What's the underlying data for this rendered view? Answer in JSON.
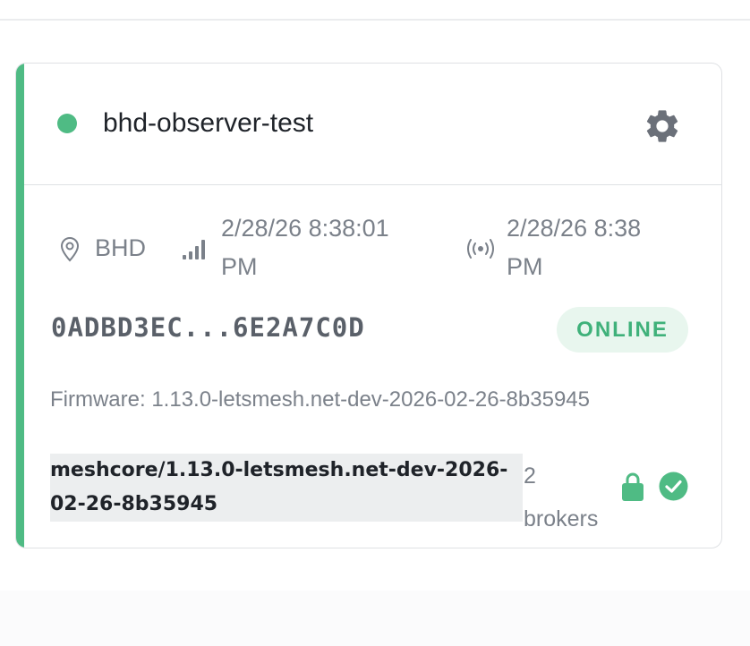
{
  "node": {
    "name": "bhd-observer-test",
    "location": "BHD",
    "last_seen": [
      "2/28/26 8:38:01",
      "PM"
    ],
    "last_broadcast": [
      "2/28/26 8:38",
      "PM"
    ],
    "id": "0ADBD3EC...6E2A7C0D",
    "status": "ONLINE",
    "firmware": "Firmware: 1.13.0-letsmesh.net-dev-2026-02-26-8b35945",
    "client_lines": [
      "meshcore/1.13.0-letsmesh.net-dev-2026-",
      "02-26-8b35945"
    ],
    "brokers": [
      "2",
      "brokers"
    ]
  },
  "icons": {
    "status": "status-dot",
    "settings": "gear-icon",
    "location": "map-pin-icon",
    "signal": "signal-bars-icon",
    "broadcast": "broadcast-icon",
    "lock": "lock-icon",
    "verified": "check-circle-icon"
  },
  "colors": {
    "accent": "#4fbb84",
    "online": "#3fb17a",
    "online_bg": "#e8f6ee",
    "gear": "#6b7079",
    "muted": "#7b818a"
  }
}
